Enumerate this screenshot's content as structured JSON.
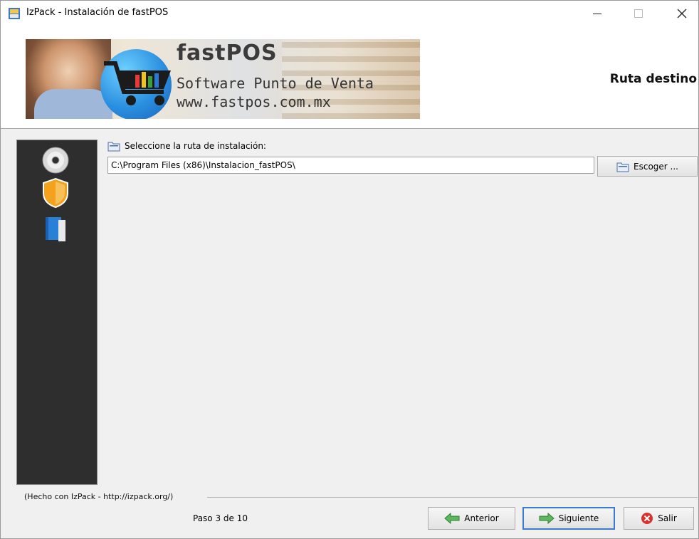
{
  "window": {
    "title": "IzPack - Instalación de fastPOS"
  },
  "banner": {
    "brand": "fastPOS",
    "subtitle": "Software Punto de Venta",
    "url": "www.fastpos.com.mx"
  },
  "panel": {
    "title": "Ruta destino"
  },
  "path": {
    "label": "Seleccione la ruta de instalación:",
    "value": "C:\\Program Files (x86)\\Instalacion_fastPOS\\",
    "choose_label": "Escoger ..."
  },
  "footer": {
    "made_with": "(Hecho con IzPack - http://izpack.org/)",
    "step": "Paso 3 de 10",
    "prev_label": "Anterior",
    "next_label": "Siguiente",
    "exit_label": "Salir"
  },
  "icons": {
    "app": "installer-icon",
    "sidebar": [
      "cd-icon",
      "shield-icon",
      "book-icon"
    ],
    "folder": "folder-icon",
    "prev": "arrow-left-icon",
    "next": "arrow-right-icon",
    "exit": "close-circle-icon"
  },
  "colors": {
    "sidebar_bg": "#2e2e2e",
    "next_border": "#3a7bd5",
    "exit_red": "#d9312b"
  }
}
